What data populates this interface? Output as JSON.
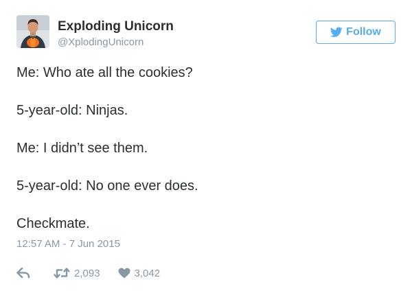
{
  "user": {
    "display_name": "Exploding Unicorn",
    "screen_name": "@XplodingUnicorn"
  },
  "follow_button": {
    "label": "Follow",
    "icon": "twitter-bird-icon"
  },
  "tweet": {
    "lines": [
      "Me: Who ate all the cookies?",
      "5-year-old: Ninjas.",
      "Me: I didn’t see them.",
      "5-year-old: No one ever does.",
      "Checkmate."
    ],
    "timestamp": "12:57 AM - 7 Jun 2015"
  },
  "actions": {
    "reply_icon": "reply-icon",
    "retweet_icon": "retweet-icon",
    "retweet_count": "2,093",
    "like_icon": "heart-icon",
    "like_count": "3,042"
  },
  "colors": {
    "accent": "#55acee",
    "text": "#292f33",
    "secondary": "#8899a6"
  }
}
